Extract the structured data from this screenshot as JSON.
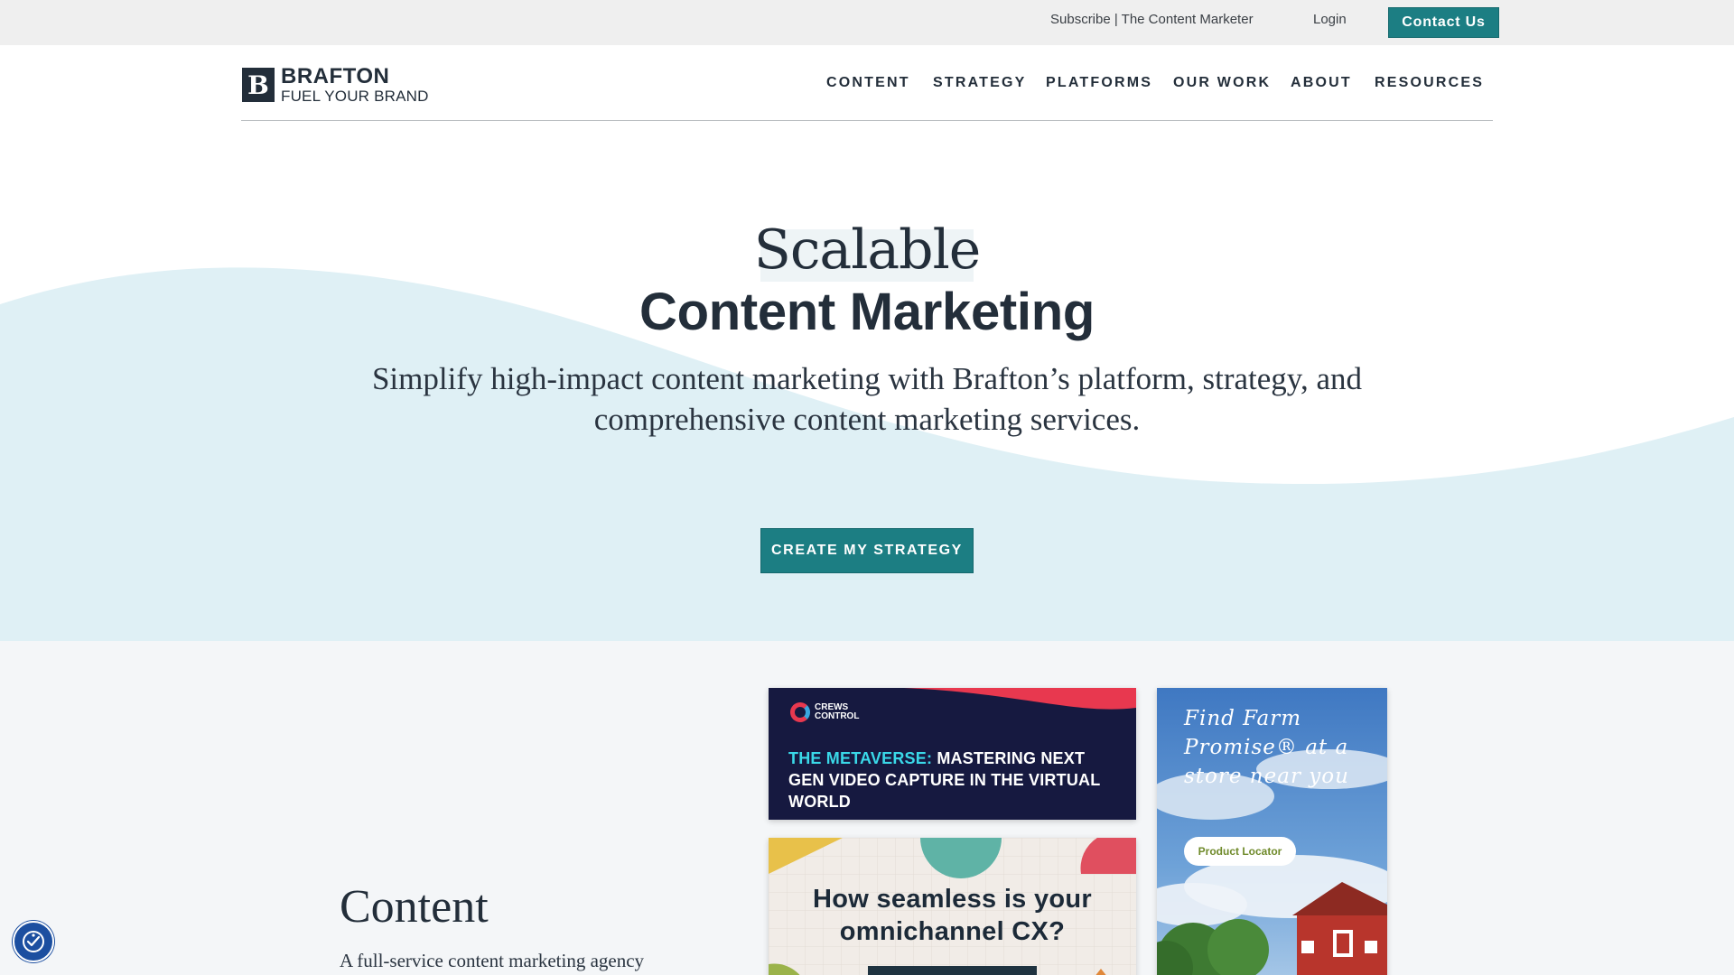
{
  "utility_bar": {
    "subscribe_label": "Subscribe | The Content Marketer",
    "login_label": "Login",
    "contact_label": "Contact Us"
  },
  "header": {
    "logo": {
      "name": "BRAFTON",
      "tagline": "FUEL YOUR BRAND",
      "mark": "B"
    },
    "nav": [
      {
        "label": "CONTENT"
      },
      {
        "label": "STRATEGY"
      },
      {
        "label": "PLATFORMS"
      },
      {
        "label": "OUR WORK"
      },
      {
        "label": "ABOUT"
      },
      {
        "label": "RESOURCES"
      }
    ]
  },
  "hero": {
    "eyebrow": "Scalable",
    "title": "Content Marketing",
    "subtitle": "Simplify high-impact content marketing with Brafton’s platform, strategy, and comprehensive content marketing services.",
    "cta_label": "CREATE MY STRATEGY"
  },
  "content_section": {
    "title": "Content",
    "description": "A full-service content marketing agency",
    "cards": {
      "crews": {
        "brand_line1": "CREWS",
        "brand_line2": "CONTROL",
        "headline_accent": "THE METAVERSE:",
        "headline_rest": " MASTERING NEXT GEN VIDEO CAPTURE IN THE VIRTUAL WORLD"
      },
      "omni": {
        "headline": "How seamless is your omnichannel CX?"
      },
      "farm": {
        "headline": "Find Farm Promise® at a store near you",
        "button_label": "Product Locator"
      }
    }
  },
  "colors": {
    "brand_teal": "#1c7e83",
    "navy": "#232e3a",
    "hero_wave": "#dff0f5",
    "section_bg": "#f4f6f8"
  },
  "icons": {
    "accessibility": "accessibility-icon"
  }
}
